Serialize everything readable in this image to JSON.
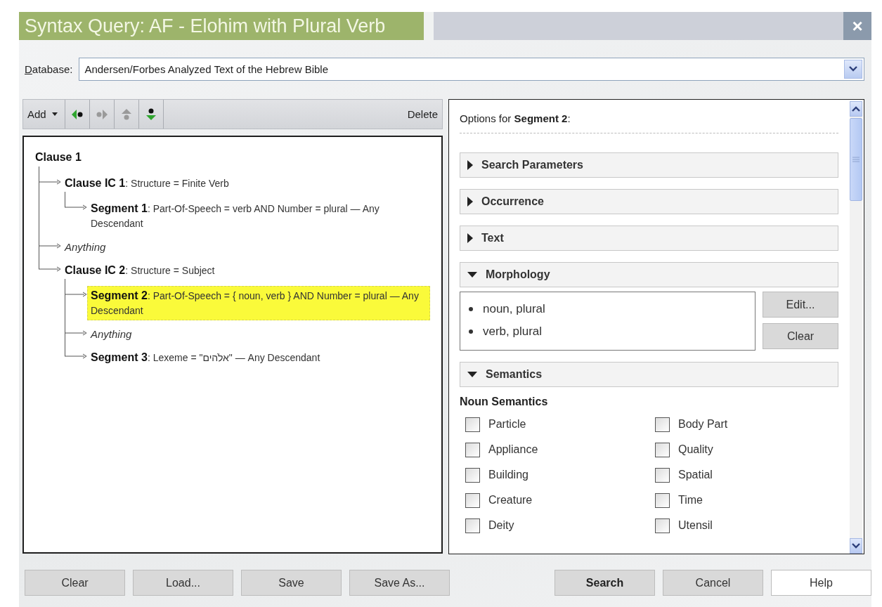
{
  "window": {
    "title": "Syntax Query: AF - Elohim with Plural Verb",
    "close": "×"
  },
  "database": {
    "label": "Database:",
    "value": "Andersen/Forbes Analyzed Text of the Hebrew Bible"
  },
  "toolbar": {
    "add": "Add",
    "buttons": [
      {
        "kind": "move-left",
        "disabled": false
      },
      {
        "kind": "move-right",
        "disabled": true
      },
      {
        "kind": "move-up",
        "disabled": true
      },
      {
        "kind": "move-down",
        "disabled": false
      }
    ],
    "delete": "Delete"
  },
  "tree": {
    "text": "Clause 1",
    "children": [
      {
        "kind": "node",
        "text": "**Clause IC 1**: Structure = Finite Verb",
        "selected": false,
        "children": [
          {
            "kind": "node",
            "text": "**Segment 1**: Part-Of-Speech = verb AND Number = plural — Any Descendant",
            "selected": false
          }
        ]
      },
      {
        "kind": "anything",
        "text": "Anything",
        "selected": false
      },
      {
        "kind": "node",
        "text": "**Clause IC 2**: Structure = Subject",
        "selected": false,
        "children": [
          {
            "kind": "node",
            "text": "**Segment 2**: Part-Of-Speech = { noun, verb } AND Number = plural — Any Descendant",
            "selected": true
          },
          {
            "kind": "anything",
            "text": "Anything",
            "selected": false
          },
          {
            "kind": "node",
            "text": "**Segment 3**: Lexeme = \"אלֹהים\" — Any Descendant",
            "selected": false
          }
        ]
      }
    ]
  },
  "options": {
    "heading": "Options for **Segment 2**:",
    "sections": [
      {
        "title": "Search Parameters",
        "expanded": false
      },
      {
        "title": "Occurrence",
        "expanded": false
      },
      {
        "title": "Text",
        "expanded": false
      },
      {
        "kind": "list",
        "title": "Morphology",
        "expanded": true,
        "items": [
          "noun, plural",
          "verb, plural"
        ],
        "buttons": [
          "Edit...",
          "Clear"
        ]
      },
      {
        "kind": "checkboxes",
        "title": "Semantics",
        "expanded": true,
        "subheading": "Noun Semantics",
        "checkboxes": [
          {
            "label": "Particle",
            "checked": false
          },
          {
            "label": "Body Part",
            "checked": false
          },
          {
            "label": "Appliance",
            "checked": false
          },
          {
            "label": "Quality",
            "checked": false
          },
          {
            "label": "Building",
            "checked": false
          },
          {
            "label": "Spatial",
            "checked": false
          },
          {
            "label": "Creature",
            "checked": false
          },
          {
            "label": "Time",
            "checked": false
          },
          {
            "label": "Deity",
            "checked": false
          },
          {
            "label": "Utensil",
            "checked": false
          }
        ]
      }
    ]
  },
  "footer": {
    "left_buttons": [
      {
        "label": "Clear"
      },
      {
        "label": "Load..."
      },
      {
        "label": "Save"
      },
      {
        "label": "Save As..."
      }
    ],
    "right_buttons": [
      {
        "label": "Search",
        "kind": "default"
      },
      {
        "label": "Cancel"
      },
      {
        "label": "Help",
        "kind": "light"
      }
    ]
  }
}
